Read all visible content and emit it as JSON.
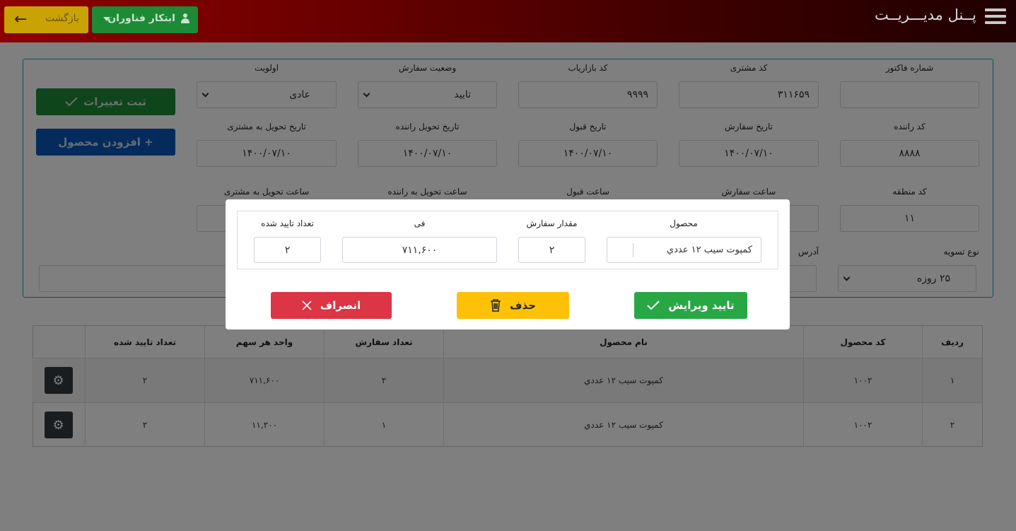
{
  "header": {
    "brand": "پــنل مديـــريــت",
    "user_button": "ابتکار فناوران",
    "back_button": "بازگشت"
  },
  "form": {
    "invoice_number": {
      "label": "شماره فاکتور",
      "value": ""
    },
    "customer_code": {
      "label": "کد مشتری",
      "value": "۳۱۱۶۵۹"
    },
    "marketer_code": {
      "label": "کد بازاریاب",
      "value": "۹۹۹۹"
    },
    "order_status": {
      "label": "وضعیت سفارش",
      "value": "تایید"
    },
    "priority": {
      "label": "اولویت",
      "value": "عادی"
    },
    "driver_code": {
      "label": "کد راننده",
      "value": "۸۸۸۸"
    },
    "order_date": {
      "label": "تاریخ سفارش",
      "value": "۱۴۰۰/۰۷/۱۰"
    },
    "accept_date": {
      "label": "تاریخ قبول",
      "value": "۱۴۰۰/۰۷/۱۰"
    },
    "driver_delivery_date": {
      "label": "تاریخ تحویل راننده",
      "value": "۱۴۰۰/۰۷/۱۰"
    },
    "customer_delivery_date": {
      "label": "تاریخ تحویل به مشتری",
      "value": "۱۴۰۰/۰۷/۱۰"
    },
    "region_code": {
      "label": "کد منطقه",
      "value": "۱۱"
    },
    "order_time": {
      "label": "ساعت سفارش"
    },
    "accept_time": {
      "label": "ساعت قبول"
    },
    "driver_delivery_time": {
      "label": "ساعت تحویل به راننده"
    },
    "customer_delivery_time": {
      "label": "ساعت تحویل به مشتری"
    },
    "settlement_type": {
      "label": "نوع تسویه",
      "value": "۲۵ روزه"
    },
    "address": {
      "label": "آدرس"
    },
    "save_button": "ثبت تغییرات",
    "add_product_button": "+ افزودن محصول"
  },
  "table": {
    "headers": [
      "ردیف",
      "کد محصول",
      "نام محصول",
      "تعداد سفارش",
      "واحد هر سهم",
      "تعداد تایید شده"
    ],
    "rows": [
      {
        "row": "۱",
        "code": "۱۰۰۲",
        "name": "کمپوت سیب ۱۲ عددي",
        "qty": "۲",
        "unit": "۷۱۱,۶۰۰",
        "approved": "۲"
      },
      {
        "row": "۲",
        "code": "۱۰۰۲",
        "name": "کمپوت سیب ۱۲ عددي",
        "qty": "۱",
        "unit": "۱۱,۲۰۰",
        "approved": "۲"
      }
    ]
  },
  "modal": {
    "product": {
      "label": "محصول",
      "value": "کمپوت سیب ۱۲ عددي"
    },
    "order_amount": {
      "label": "مقدار سفارش",
      "value": "۲"
    },
    "fee": {
      "label": "فی",
      "value": "۷۱۱,۶۰۰"
    },
    "approved_count": {
      "label": "تعداد تایید شده",
      "value": "۲"
    },
    "confirm_button": "تایید ویرایش",
    "delete_button": "حذف",
    "cancel_button": "انصراف"
  },
  "colors": {
    "confirm": "#28a745",
    "delete": "#ffc107",
    "cancel": "#dc3545",
    "panel_border": "#17a2b8"
  }
}
